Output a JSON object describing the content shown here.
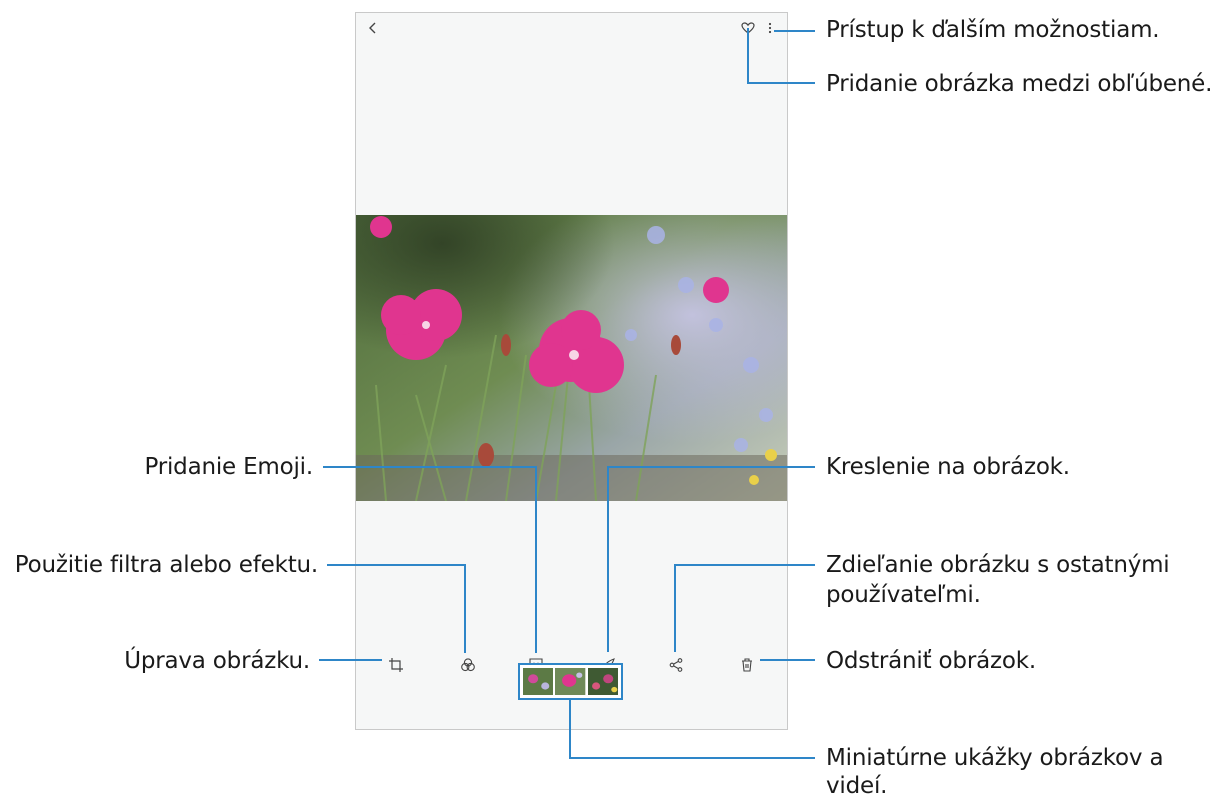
{
  "toolbar": {
    "back_icon": "back-arrow-icon",
    "favorite_icon": "heart-icon",
    "more_icon": "more-options-icon"
  },
  "bottom_bar": {
    "icons": [
      "edit-crop-icon",
      "filter-effect-icon",
      "emoji-sticker-icon",
      "draw-brush-icon",
      "share-icon",
      "trash-icon"
    ]
  },
  "callouts": {
    "more_options": "Prístup k ďalším možnostiam.",
    "favorite": "Pridanie obrázka medzi obľúbené.",
    "emoji": "Pridanie Emoji.",
    "draw": "Kreslenie na obrázok.",
    "filter": "Použitie filtra alebo efektu.",
    "share_line1": "Zdieľanie obrázku s ostatnými",
    "share_line2": "používateľmi.",
    "edit": "Úprava obrázku.",
    "delete": "Odstrániť obrázok.",
    "thumbs_line1": "Miniatúrne ukážky obrázkov a",
    "thumbs_line2": "videí."
  },
  "colors": {
    "leader_line": "#2e86c8",
    "screen_bg": "#f6f7f7",
    "flower_pink": "#e0358f"
  }
}
